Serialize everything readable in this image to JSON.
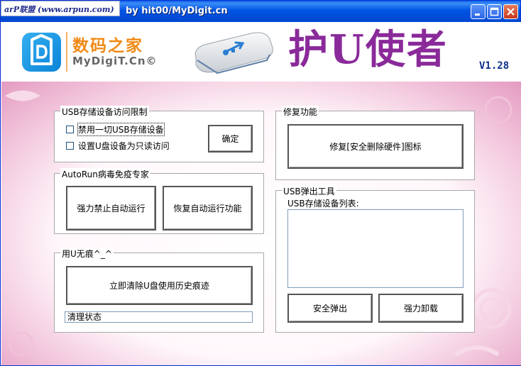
{
  "window": {
    "title": "by hit00/MyDigit.cn",
    "watermark": "arP联盟 (www.arpun.com)",
    "controls": {
      "minimize_icon": "minimize-icon",
      "maximize_icon": "maximize-icon",
      "close_icon": "close-icon"
    }
  },
  "header": {
    "brand_cn": "数码之家",
    "brand_en": "MyDigiT.Cn©",
    "app_title": "护U使者",
    "version": "V1.28"
  },
  "usb_restrict": {
    "legend": "USB存储设备访问限制",
    "options": [
      {
        "label": "禁用一切USB存储设备",
        "checked": false
      },
      {
        "label": "设置U盘设备为只读访问",
        "checked": false
      }
    ],
    "confirm_label": "确定"
  },
  "autorun": {
    "legend": "AutoRun病毒免疫专家",
    "disable_label": "强力禁止自动运行",
    "restore_label": "恢复自动运行功能"
  },
  "no_trace": {
    "legend": "用U无痕^_^",
    "clear_label": "立即清除U盘使用历史痕迹",
    "status_text": "清理状态"
  },
  "repair": {
    "legend": "修复功能",
    "repair_label": "修复[安全删除硬件]图标"
  },
  "eject": {
    "legend": "USB弹出工具",
    "list_label": "USB存储设备列表:",
    "safe_eject_label": "安全弹出",
    "force_unload_label": "强力卸载"
  },
  "colors": {
    "titlebar": "#0054e3",
    "brand_orange": "#f08a16",
    "app_title_purple": "#8a2a9a",
    "pink_frame": "#e49bc1"
  }
}
